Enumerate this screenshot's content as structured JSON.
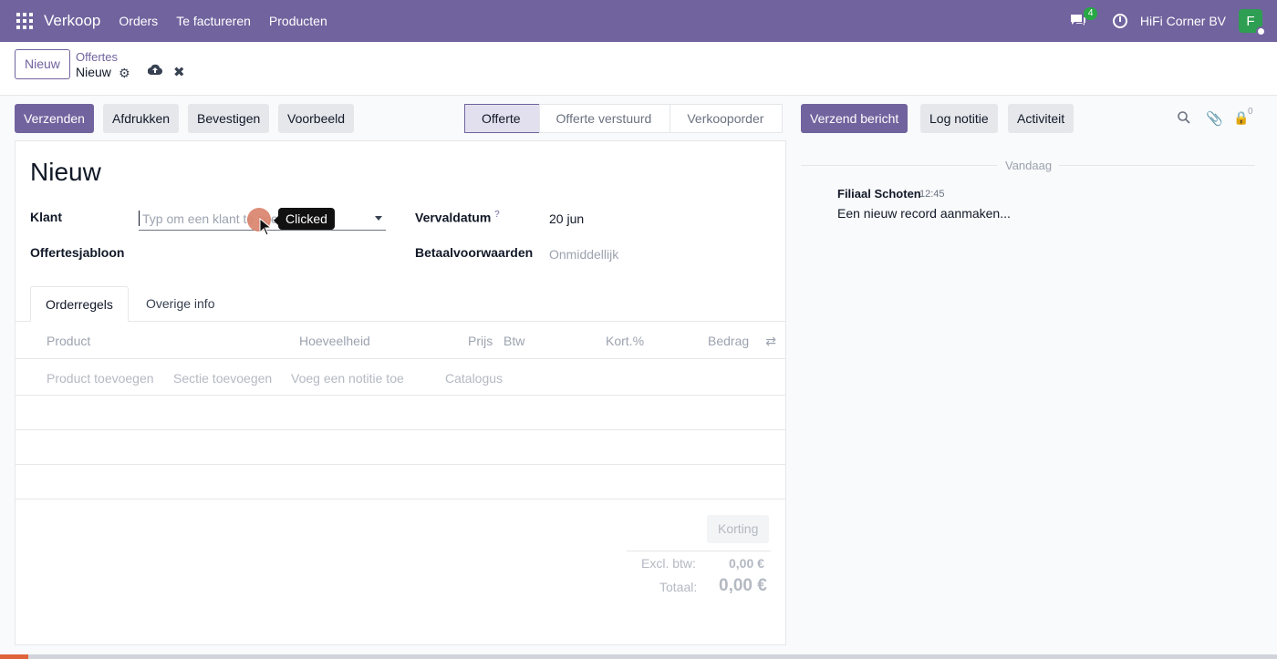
{
  "topbar": {
    "app_name": "Verkoop",
    "menu": [
      "Orders",
      "Te factureren",
      "Producten"
    ],
    "chat_count": "4",
    "company": "HiFi Corner BV",
    "avatar_letter": "F"
  },
  "control_panel": {
    "new_button": "Nieuw",
    "breadcrumb_parent": "Offertes",
    "breadcrumb_current": "Nieuw"
  },
  "actions": [
    "Verzenden",
    "Afdrukken",
    "Bevestigen",
    "Voorbeeld"
  ],
  "statusbar": [
    "Offerte",
    "Offerte verstuurd",
    "Verkooporder"
  ],
  "form": {
    "title": "Nieuw",
    "klant_label": "Klant",
    "klant_placeholder": "Typ om een klant te zoeken",
    "template_label": "Offertesjabloon",
    "expiry_label": "Vervaldatum",
    "expiry_help": "?",
    "expiry_value": "20 jun",
    "payment_label": "Betaalvoorwaarden",
    "payment_placeholder": "Onmiddellijk",
    "tabs": [
      "Orderregels",
      "Overige info"
    ],
    "columns": [
      "Product",
      "Hoeveelheid",
      "Prijs",
      "Btw",
      "Kort.%",
      "Bedrag"
    ],
    "add_links": [
      "Product toevoegen",
      "Sectie toevoegen",
      "Voeg een notitie toe",
      "Catalogus"
    ],
    "korting_button": "Korting",
    "excl_label": "Excl. btw:",
    "excl_value": "0,00 €",
    "total_label": "Totaal:",
    "total_value": "0,00 €"
  },
  "tooltip": "Clicked",
  "chatter": {
    "buttons": [
      "Verzend bericht",
      "Log notitie",
      "Activiteit"
    ],
    "followers_count": "0",
    "date_separator": "Vandaag",
    "message": {
      "author": "Filiaal Schoten",
      "time": "12:45",
      "body": "Een nieuw record aanmaken..."
    }
  },
  "progress": 0.022
}
